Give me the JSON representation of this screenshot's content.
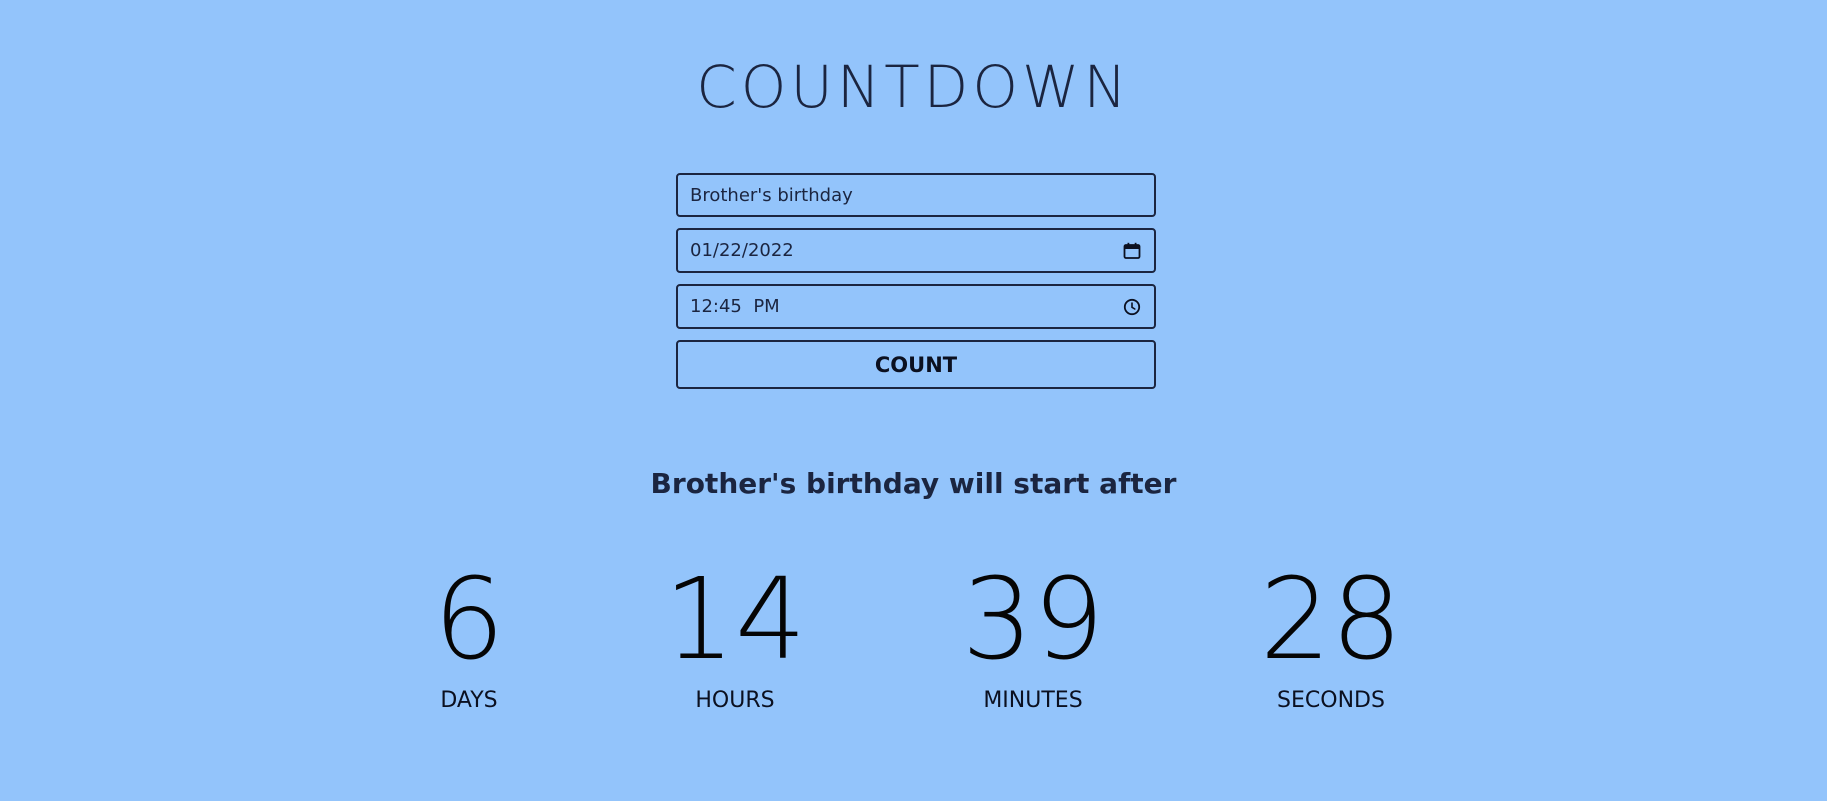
{
  "title": "COUNTDOWN",
  "form": {
    "event_name_value": "Brother's birthday",
    "date_value": "01/22/2022",
    "time_value": "12:45  PM",
    "count_button_label": "COUNT"
  },
  "message": "Brother's birthday will start after",
  "countdown": {
    "days": {
      "value": "6",
      "label": "DAYS"
    },
    "hours": {
      "value": "14",
      "label": "HOURS"
    },
    "minutes": {
      "value": "39",
      "label": "MINUTES"
    },
    "seconds": {
      "value": "28",
      "label": "SECONDS"
    }
  },
  "colors": {
    "background": "#93c4fb",
    "text": "#1b2540"
  },
  "icons": {
    "date": "calendar-icon",
    "time": "clock-icon"
  }
}
